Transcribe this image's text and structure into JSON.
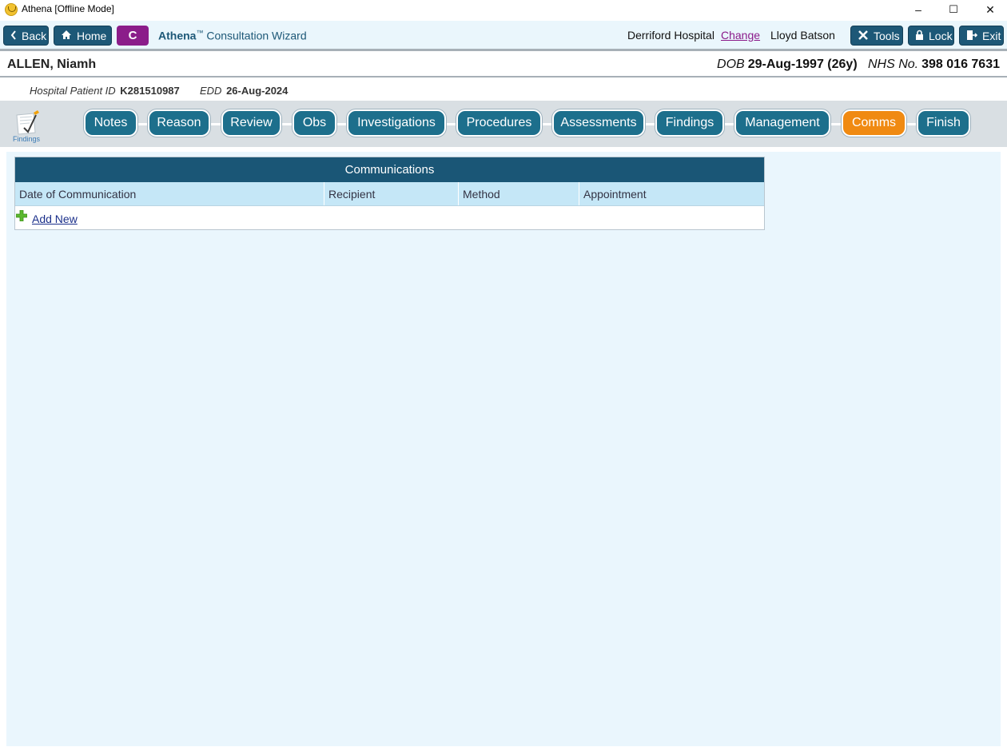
{
  "window": {
    "title": "Athena [Offline Mode]",
    "controls": [
      "–",
      "☐",
      "✕"
    ]
  },
  "toolbar": {
    "back_label": "Back",
    "home_label": "Home",
    "c_label": "C",
    "wizard_brand": "Athena",
    "wizard_tm": "™",
    "wizard_title": " Consultation Wizard",
    "hospital": "Derriford Hospital",
    "change_label": "Change",
    "user": "Lloyd Batson",
    "tools_label": "Tools",
    "lock_label": "Lock",
    "exit_label": "Exit"
  },
  "patient": {
    "name": "ALLEN, Niamh",
    "dob_label": "DOB",
    "dob": "29-Aug-1997 (26y)",
    "nhs_label": "NHS No.",
    "nhs": "398 016 7631",
    "hospital_id_label": "Hospital Patient ID",
    "hospital_id": "K281510987",
    "edd_label": "EDD",
    "edd": "26-Aug-2024"
  },
  "stepbar": {
    "icon_label": "Findings",
    "steps": [
      "Notes",
      "Reason",
      "Review",
      "Obs",
      "Investigations",
      "Procedures",
      "Assessments",
      "Findings",
      "Management",
      "Comms",
      "Finish"
    ],
    "active": "Comms"
  },
  "communications": {
    "title": "Communications",
    "columns": [
      "Date of Communication",
      "Recipient",
      "Method",
      "Appointment"
    ],
    "add_label": "Add New"
  },
  "colors": {
    "primary": "#1d5877",
    "step": "#1d6f8c",
    "active_step": "#f08a12",
    "c_button": "#8b1d8a",
    "content_bg": "#eaf6fd",
    "column_header_bg": "#c5e7f7"
  }
}
